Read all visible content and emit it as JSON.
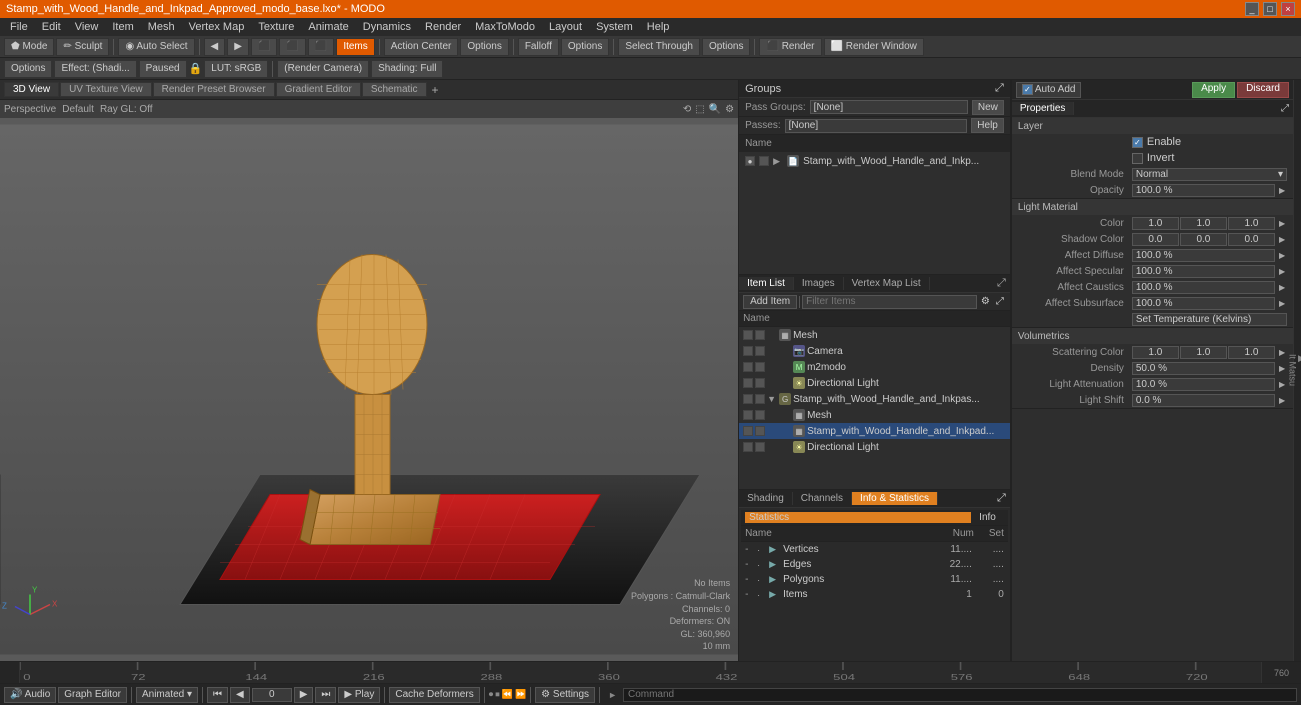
{
  "titleBar": {
    "title": "Stamp_with_Wood_Handle_and_Inkpad_Approved_modo_base.lxo* - MODO",
    "controls": [
      "_",
      "□",
      "×"
    ]
  },
  "menuBar": {
    "items": [
      "File",
      "Edit",
      "View",
      "Item",
      "Mesh",
      "Vertex Map",
      "Texture",
      "Animate",
      "Dynamics",
      "Render",
      "MaxToModo",
      "Layout",
      "System",
      "Help"
    ]
  },
  "toolbar": {
    "mode_btns": [
      "Mode",
      "Sculpt"
    ],
    "select_btn": "Auto Select",
    "tool_btns": [
      "◀",
      "▶",
      "⬛",
      "⬛",
      "⬛"
    ],
    "items_btn": "Items",
    "action_center": "Action Center",
    "options1": "Options",
    "falloff": "Falloff",
    "options2": "Options",
    "select_through": "Select Through",
    "options3": "Options",
    "render": "Render",
    "render_window": "Render Window"
  },
  "toolbar2": {
    "options_label": "Options",
    "effect_label": "Effect: (Shadi...",
    "paused": "Paused",
    "lock_icon": "🔒",
    "lut": "LUT: sRGB",
    "render_camera": "(Render Camera)",
    "shading": "Shading: Full"
  },
  "viewTabs": {
    "tabs": [
      "3D View",
      "UV Texture View",
      "Render Preset Browser",
      "Gradient Editor",
      "Schematic"
    ],
    "add": "+"
  },
  "viewport": {
    "perspective": "Perspective",
    "default": "Default",
    "ray_gl": "Ray GL: Off",
    "stats": {
      "no_items": "No Items",
      "polygons": "Polygons : Catmull-Clark",
      "channels": "Channels: 0",
      "deformers": "Deformers: ON",
      "gl": "GL: 360,960",
      "grid": "10 mm"
    }
  },
  "groups": {
    "title": "Groups",
    "expand_icon": "⤢",
    "pass_groups_label": "Pass Groups:",
    "pass_groups_value": "[None]",
    "new_btn": "New",
    "passes_label": "Passes:",
    "passes_value": "[None]",
    "help_btn": "Help",
    "name_col": "Name"
  },
  "groupItem": {
    "icon": "📄",
    "name": "Stamp_with_Wood_Handle_and_Inkp...",
    "expand": "▶"
  },
  "actionRow": {
    "auto_add_label": "Auto Add",
    "apply_label": "Apply",
    "discard_label": "Discard"
  },
  "properties": {
    "title": "Properties",
    "tab": "Properties",
    "layer_section": "Layer",
    "enable_label": "Enable",
    "enable_checked": true,
    "invert_label": "Invert",
    "invert_checked": false,
    "blend_mode_label": "Blend Mode",
    "blend_mode_value": "Normal",
    "opacity_label": "Opacity",
    "opacity_value": "100.0 %",
    "light_material": "Light Material",
    "color_label": "Color",
    "color_r": "1.0",
    "color_g": "1.0",
    "color_b": "1.0",
    "shadow_color_label": "Shadow Color",
    "shadow_r": "0.0",
    "shadow_g": "0.0",
    "shadow_b": "0.0",
    "affect_diffuse_label": "Affect Diffuse",
    "affect_diffuse_value": "100.0 %",
    "affect_specular_label": "Affect Specular",
    "affect_specular_value": "100.0 %",
    "affect_caustics_label": "Affect Caustics",
    "affect_caustics_value": "100.0 %",
    "affect_subsurface_label": "Affect Subsurface",
    "affect_subsurface_value": "100.0 %",
    "set_temperature_label": "Set Temperature (Kelvins)",
    "volumetrics_section": "Volumetrics",
    "scattering_color_label": "Scattering Color",
    "scattering_r": "1.0",
    "scattering_g": "1.0",
    "scattering_b": "1.0",
    "density_label": "Density",
    "density_value": "50.0 %",
    "light_attenuation_label": "Light Attenuation",
    "light_attenuation_value": "10.0 %",
    "light_shift_label": "Light Shift",
    "light_shift_value": "0.0 %"
  },
  "itemsList": {
    "tabs": [
      "Item List",
      "Images",
      "Vertex Map List"
    ],
    "add_item": "Add Item",
    "filter_placeholder": "Filter Items",
    "name_col": "Name",
    "items": [
      {
        "type": "mesh",
        "indent": 0,
        "name": "Mesh",
        "expand": false,
        "selected": false
      },
      {
        "type": "camera",
        "indent": 1,
        "name": "Camera",
        "expand": false,
        "selected": false
      },
      {
        "type": "m2modo",
        "indent": 1,
        "name": "m2modo",
        "expand": false,
        "selected": false
      },
      {
        "type": "light",
        "indent": 1,
        "name": "Directional Light",
        "expand": false,
        "selected": false
      },
      {
        "type": "group",
        "indent": 0,
        "name": "Stamp_with_Wood_Handle_and_Inkpas...",
        "expand": true,
        "selected": false
      },
      {
        "type": "mesh",
        "indent": 1,
        "name": "Mesh",
        "expand": false,
        "selected": false
      },
      {
        "type": "mesh",
        "indent": 1,
        "name": "Stamp_with_Wood_Handle_and_Inkpad...",
        "expand": false,
        "selected": true
      },
      {
        "type": "light",
        "indent": 1,
        "name": "Directional Light",
        "expand": false,
        "selected": false
      }
    ]
  },
  "stats": {
    "tabs": [
      "Shading",
      "Channels",
      "Info & Statistics"
    ],
    "active_tab": "Info & Statistics",
    "section": "Statistics",
    "info_btn": "Info",
    "cols": {
      "name": "Name",
      "num": "Num",
      "set": "Set"
    },
    "rows": [
      {
        "name": "Vertices",
        "num": "11...",
        "set": "...."
      },
      {
        "name": "Edges",
        "num": "22....",
        "set": "...."
      },
      {
        "name": "Polygons",
        "num": "11...",
        "set": "...."
      },
      {
        "name": "Items",
        "num": "1",
        "set": "0"
      }
    ]
  },
  "timeline": {
    "ticks": [
      0,
      72,
      144,
      216,
      288,
      360,
      432,
      504,
      576,
      648,
      720
    ],
    "labels": [
      "0",
      "72",
      "144",
      "216",
      "288",
      "360",
      "432",
      "504",
      "576",
      "648",
      "720"
    ],
    "display_labels": [
      "0",
      "72",
      "144",
      "216",
      "288",
      "360",
      "432",
      "504",
      "576",
      "648",
      "720"
    ],
    "tick_positions": [
      25,
      97,
      169,
      245,
      318,
      392,
      465,
      537,
      611,
      684,
      757
    ]
  },
  "bottomBar": {
    "audio_btn": "🔊 Audio",
    "graph_btn": "Graph Editor",
    "animated_btn": "Animated",
    "frame_input": "0",
    "play_btn": "▶ Play",
    "cache_btn": "Cache Deformers",
    "settings_btn": "⚙ Settings",
    "command_placeholder": "Command"
  },
  "renderPreview": {
    "play_symbol": "▶"
  }
}
